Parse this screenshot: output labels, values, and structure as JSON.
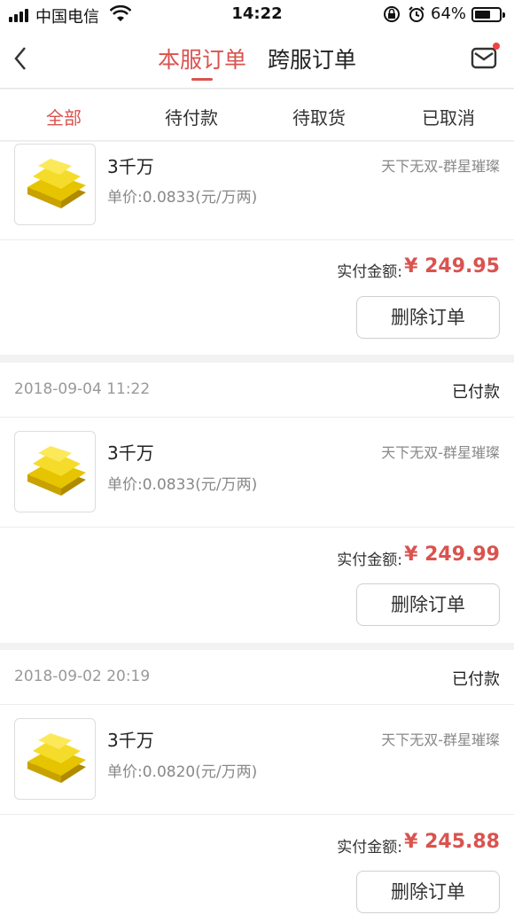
{
  "status_bar": {
    "carrier": "中国电信",
    "time": "14:22",
    "battery": "64%",
    "battery_level": 0.64
  },
  "nav": {
    "tab_local": "本服订单",
    "tab_cross": "跨服订单"
  },
  "filters": [
    "全部",
    "待付款",
    "待取货",
    "已取消"
  ],
  "orders": [
    {
      "date": "",
      "status": "",
      "name": "3千万",
      "unit_price": "单价:0.0833(元/万两)",
      "server": "天下无双-群星璀璨",
      "paid_label": "实付金额:",
      "amount": "¥ 249.95",
      "delete_label": "删除订单"
    },
    {
      "date": "2018-09-04 11:22",
      "status": "已付款",
      "name": "3千万",
      "unit_price": "单价:0.0833(元/万两)",
      "server": "天下无双-群星璀璨",
      "paid_label": "实付金额:",
      "amount": "¥ 249.99",
      "delete_label": "删除订单"
    },
    {
      "date": "2018-09-02 20:19",
      "status": "已付款",
      "name": "3千万",
      "unit_price": "单价:0.0820(元/万两)",
      "server": "天下无双-群星璀璨",
      "paid_label": "实付金额:",
      "amount": "¥ 245.88",
      "delete_label": "删除订单"
    }
  ],
  "colors": {
    "accent": "#d9534f",
    "background": "#f2f2f2"
  }
}
